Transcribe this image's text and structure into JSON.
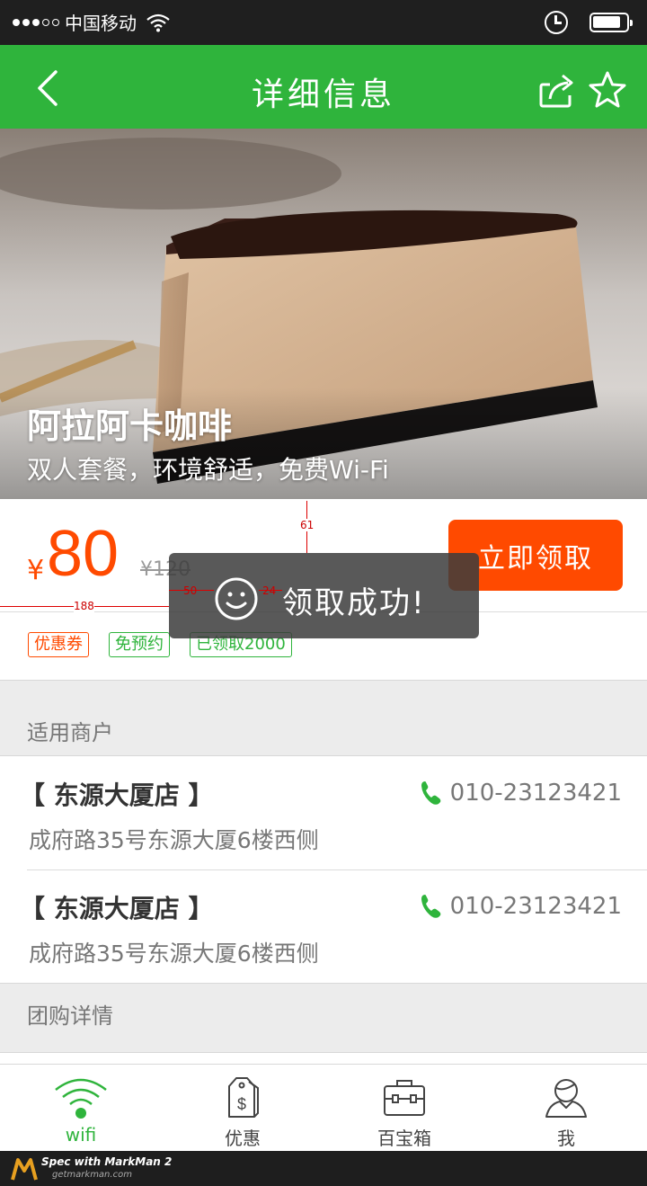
{
  "status_bar": {
    "carrier": "中国移动",
    "signal_full": 3,
    "signal_total": 5
  },
  "nav": {
    "title": "详细信息"
  },
  "hero": {
    "title": "阿拉阿卡咖啡",
    "subtitle": "双人套餐，环境舒适，免费Wi-Fi"
  },
  "deal": {
    "currency": "¥",
    "price": "80",
    "original_price": "¥120",
    "claim_label": "立即领取",
    "tags": [
      "优惠券",
      "免预约",
      "已领取2000"
    ]
  },
  "measurements": {
    "top_gap": "61",
    "left_offset": "188",
    "icon_left": "50",
    "icon_gap": "24"
  },
  "toast": {
    "message": "领取成功!"
  },
  "sections": {
    "merchants_header": "适用商户",
    "details_header": "团购详情"
  },
  "merchants": [
    {
      "name": "【 东源大厦店 】",
      "phone": "010-23123421",
      "address": "成府路35号东源大厦6楼西侧"
    },
    {
      "name": "【 东源大厦店 】",
      "phone": "010-23123421",
      "address": "成府路35号东源大厦6楼西侧"
    }
  ],
  "tab_bar": {
    "tabs": [
      "wifi",
      "优惠",
      "百宝箱",
      "我"
    ],
    "active": "wifi"
  },
  "watermark": {
    "line1": "Spec with MarkMan 2",
    "line2": "getmarkman.com"
  },
  "colors": {
    "brand_green": "#2fb43c",
    "accent_orange": "#ff4a00"
  }
}
